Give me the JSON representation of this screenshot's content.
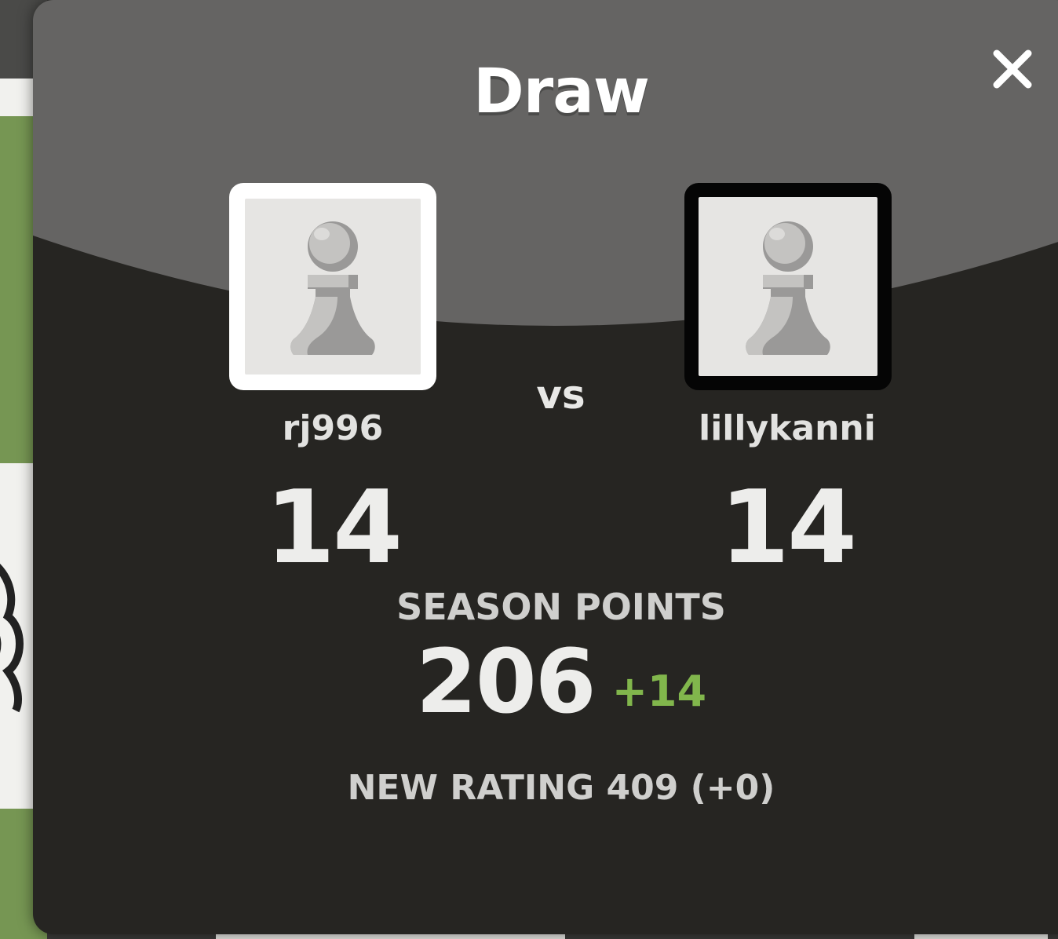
{
  "modal": {
    "title": "Draw",
    "close_icon": "close-icon",
    "vs_label": "vs",
    "player_left": {
      "name": "rj996",
      "score": "14",
      "piece_color": "white",
      "avatar_icon": "pawn-icon"
    },
    "player_right": {
      "name": "lillykanni",
      "score": "14",
      "piece_color": "black",
      "avatar_icon": "pawn-icon"
    },
    "season": {
      "label": "SEASON POINTS",
      "points": "206",
      "delta": "+14"
    },
    "rating": {
      "text": "NEW RATING 409 (+0)"
    }
  },
  "colors": {
    "modal_body": "#262522",
    "modal_header": "#656463",
    "accent_green": "#81b64c",
    "board_green": "#769653"
  }
}
